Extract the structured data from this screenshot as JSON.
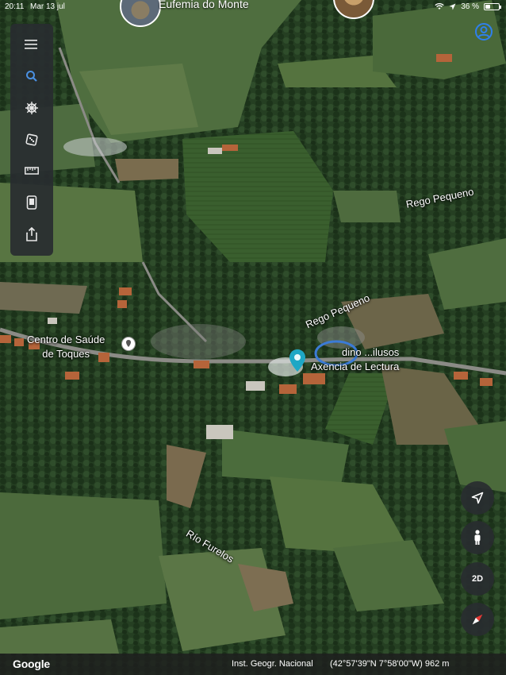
{
  "status_bar": {
    "time": "20:11",
    "date": "Mar 13 jul",
    "battery_percent": "36 %",
    "battery_level": 0.36
  },
  "top_places": {
    "title_partial": "Eufemia do Monte"
  },
  "toolbar": {
    "items": [
      {
        "name": "menu",
        "icon": "hamburger-icon"
      },
      {
        "name": "search",
        "icon": "search-icon"
      },
      {
        "name": "voyager",
        "icon": "helm-icon"
      },
      {
        "name": "feeling-lucky",
        "icon": "dice-icon"
      },
      {
        "name": "measure",
        "icon": "ruler-icon"
      },
      {
        "name": "projects",
        "icon": "phone-icon"
      },
      {
        "name": "share",
        "icon": "share-icon"
      }
    ],
    "accent": "#4a90e2"
  },
  "map_labels": {
    "centro_line1": "Centro de Saúde",
    "centro_line2": "de Toques",
    "library_line1": "dino ...ilusos",
    "library_line2": "Axencia de Lectura",
    "rego_pequeno_1": "Rego Pequeno",
    "rego_pequeno_2": "Rego Pequeno",
    "rio_furelos": "Río Furelos"
  },
  "controls": {
    "view_mode": "2D"
  },
  "bottom_bar": {
    "logo": "Google",
    "attribution": "Inst. Geogr. Nacional",
    "coordinates": "(42°57'39\"N 7°58'00\"W) 962 m"
  }
}
